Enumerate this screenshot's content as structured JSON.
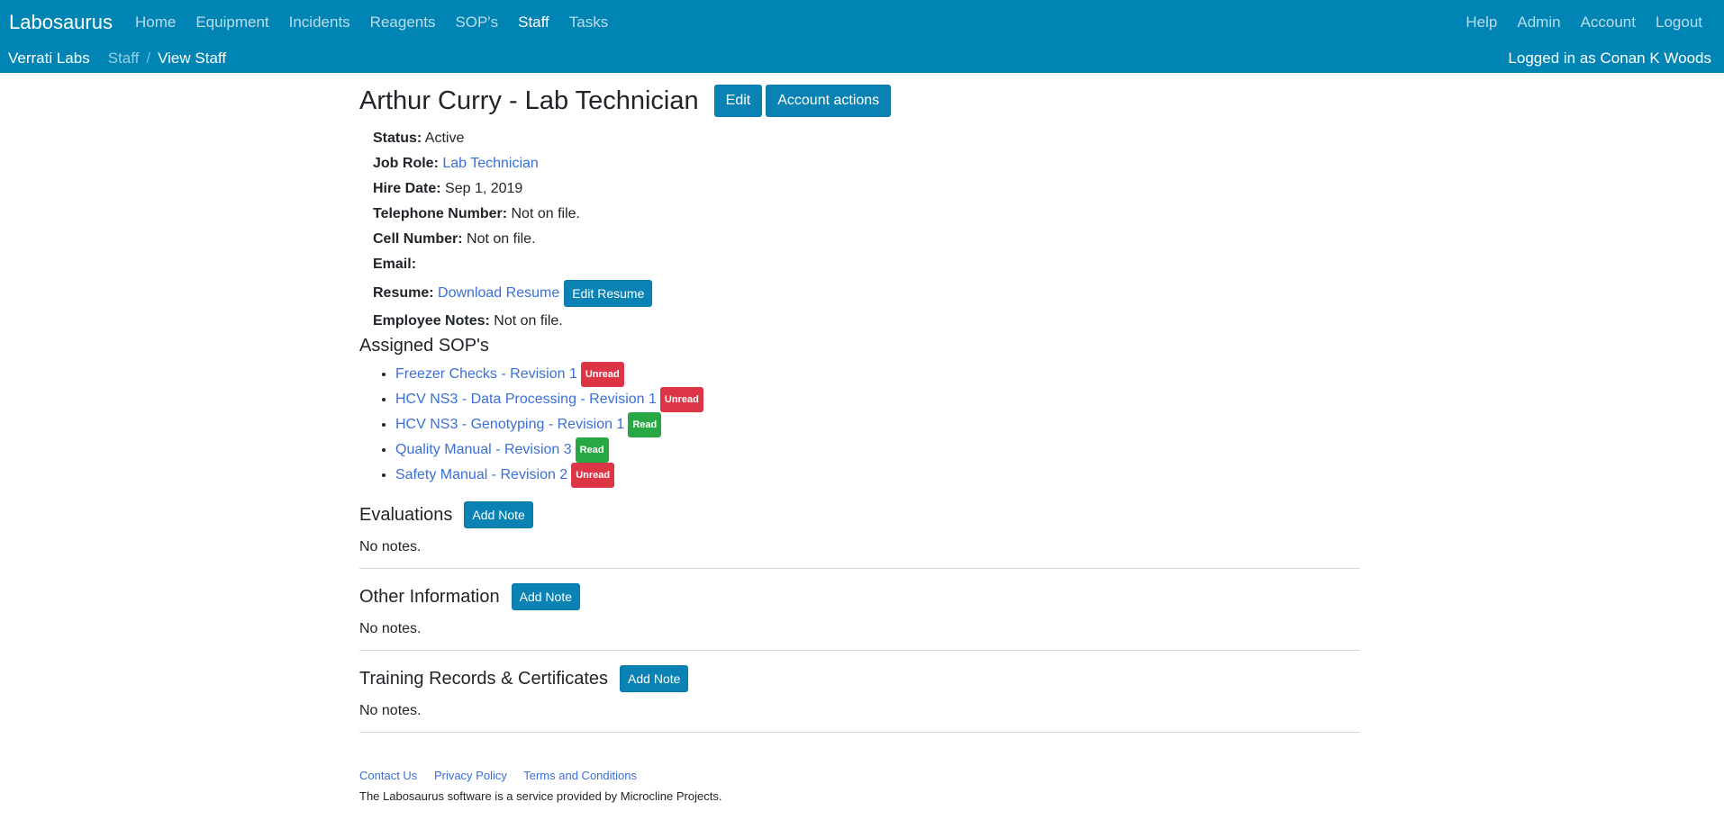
{
  "nav": {
    "brand": "Labosaurus",
    "items": [
      "Home",
      "Equipment",
      "Incidents",
      "Reagents",
      "SOP's",
      "Staff",
      "Tasks"
    ],
    "right": [
      "Help",
      "Admin",
      "Account",
      "Logout"
    ]
  },
  "subnav": {
    "org": "Verrati Labs",
    "crumbs": [
      "Staff",
      "View Staff"
    ],
    "logged_in": "Logged in as Conan K Woods"
  },
  "profile": {
    "title": "Arthur Curry - Lab Technician",
    "edit_label": "Edit",
    "account_actions_label": "Account actions",
    "fields": {
      "status_label": "Status:",
      "status": "Active",
      "job_role_label": "Job Role:",
      "job_role": "Lab Technician",
      "hire_date_label": "Hire Date:",
      "hire_date": "Sep 1, 2019",
      "telephone_label": "Telephone Number:",
      "telephone": "Not on file.",
      "cell_label": "Cell Number:",
      "cell": "Not on file.",
      "email_label": "Email:",
      "email": "",
      "resume_label": "Resume:",
      "resume_link": "Download Resume",
      "resume_edit": "Edit Resume",
      "notes_label": "Employee Notes:",
      "notes": "Not on file."
    }
  },
  "sops": {
    "heading": "Assigned SOP's",
    "items": [
      {
        "title": "Freezer Checks - Revision 1",
        "status": "Unread"
      },
      {
        "title": "HCV NS3 - Data Processing - Revision 1",
        "status": "Unread"
      },
      {
        "title": "HCV NS3 - Genotyping - Revision 1",
        "status": "Read"
      },
      {
        "title": "Quality Manual - Revision 3",
        "status": "Read"
      },
      {
        "title": "Safety Manual - Revision 2",
        "status": "Unread"
      }
    ]
  },
  "sections": [
    {
      "heading": "Evaluations",
      "button": "Add Note",
      "body": "No notes."
    },
    {
      "heading": "Other Information",
      "button": "Add Note",
      "body": "No notes."
    },
    {
      "heading": "Training Records & Certificates",
      "button": "Add Note",
      "body": "No notes."
    }
  ],
  "footer": {
    "links": [
      "Contact Us",
      "Privacy Policy",
      "Terms and Conditions"
    ],
    "text": "The Labosaurus software is a service provided by Microcline Projects."
  },
  "colors": {
    "navbar": "#0084b4",
    "button": "#0a82b4",
    "unread": "#dc3545",
    "read": "#28a745",
    "link": "#3a6fd8"
  }
}
